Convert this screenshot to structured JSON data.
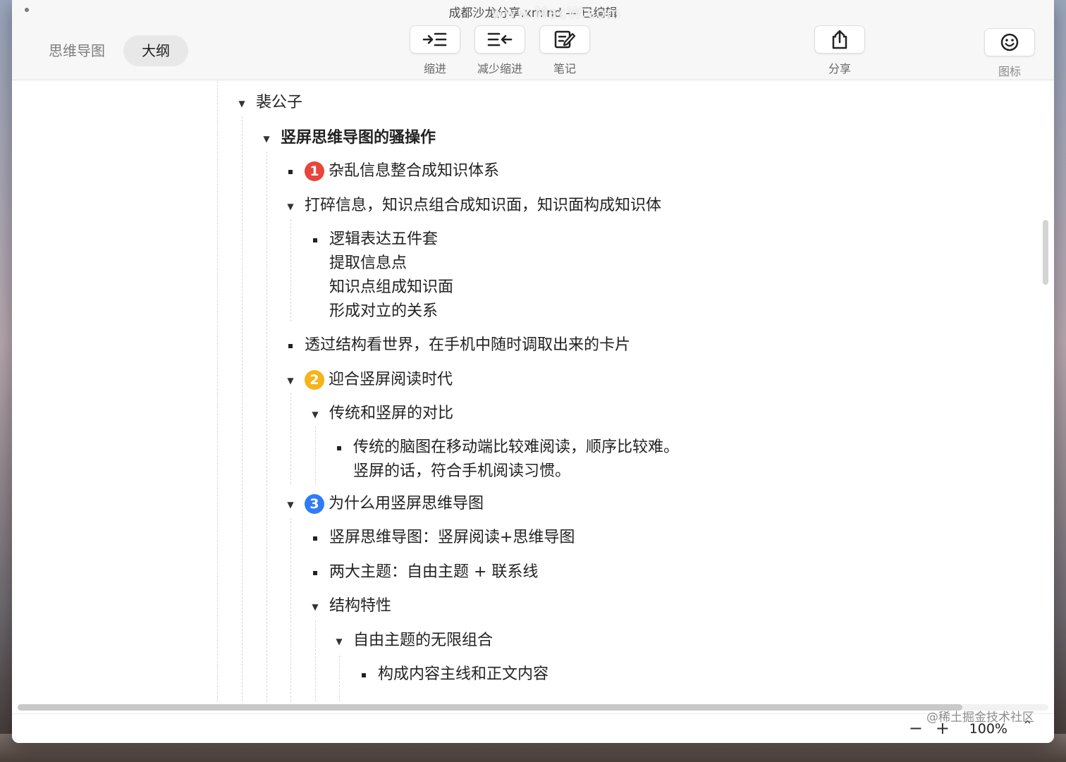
{
  "window": {
    "title": "成都沙龙分享.xmind — 已编辑",
    "watermark": "www.MacW.com"
  },
  "view_switch": {
    "mindmap_label": "思维导图",
    "outline_label": "大纲"
  },
  "toolbar": {
    "indent_label": "缩进",
    "outdent_label": "减少缩进",
    "note_label": "笔记",
    "share_label": "分享",
    "icon_label": "图标"
  },
  "outline": {
    "root": "裴公子",
    "topic": "竖屏思维导图的骚操作",
    "item1": "杂乱信息整合成知识体系",
    "item1_badge": "1",
    "item2": "打碎信息，知识点组合成知识面，知识面构成知识体",
    "item2_child": "逻辑表达五件套\n提取信息点\n知识点组成知识面\n形成对立的关系",
    "item3": "透过结构看世界，在手机中随时调取出来的卡片",
    "item4": "迎合竖屏阅读时代",
    "item4_badge": "2",
    "item4_child": "传统和竖屏的对比",
    "item4_grandchild": "传统的脑图在移动端比较难阅读，顺序比较难。\n竖屏的话，符合手机阅读习惯。",
    "item5": "为什么用竖屏思维导图",
    "item5_badge": "3",
    "item5_child1": "竖屏思维导图：竖屏阅读+思维导图",
    "item5_child2": "两大主题：自由主题 + 联系线",
    "item5_child3": "结构特性",
    "item5_child3_sub": "自由主题的无限组合",
    "item5_child3_sub_leaf": "构成内容主线和正文内容"
  },
  "badge_colors": {
    "one": "#e8453c",
    "two": "#f5b417",
    "three": "#2f7cf6"
  },
  "statusbar": {
    "zoom_minus": "−",
    "zoom_plus": "+",
    "zoom_value": "100%",
    "credit": "@稀土掘金技术社区"
  }
}
